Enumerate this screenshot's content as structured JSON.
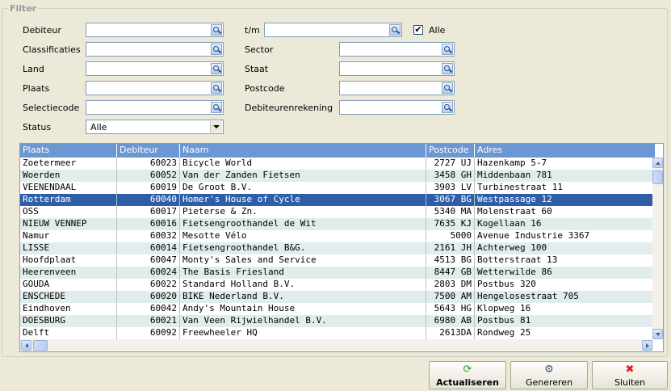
{
  "filter": {
    "title": "Filter",
    "labels": {
      "debiteur": "Debiteur",
      "tm": "t/m",
      "classificaties": "Classificaties",
      "sector": "Sector",
      "land": "Land",
      "staat": "Staat",
      "plaats": "Plaats",
      "postcode": "Postcode",
      "selectiecode": "Selectiecode",
      "debiteurenrekening": "Debiteurenrekening",
      "status": "Status",
      "alle": "Alle"
    },
    "alle_checked": "✔",
    "status_value": "Alle"
  },
  "grid": {
    "columns": [
      "Plaats",
      "Debiteur",
      "Naam",
      "Postcode",
      "Adres"
    ],
    "rows": [
      [
        "Zoetermeer",
        "60023",
        "Bicycle World",
        "2727 UJ",
        "Hazenkamp 5-7"
      ],
      [
        "Woerden",
        "60052",
        "Van der Zanden Fietsen",
        "3458 GH",
        "Middenbaan 781"
      ],
      [
        "VEENENDAAL",
        "60019",
        "De Groot B.V.",
        "3903 LV",
        "Turbinestraat 11"
      ],
      [
        "Rotterdam",
        "60040",
        "Homer's House of Cycle",
        "3067 BG",
        "Westpassage 12"
      ],
      [
        "OSS",
        "60017",
        "Pieterse & Zn.",
        "5340 MA",
        "Molenstraat 60"
      ],
      [
        "NIEUW VENNEP",
        "60016",
        "Fietsengroothandel de Wit",
        "7635 KJ",
        "Kogellaan 16"
      ],
      [
        "Namur",
        "60032",
        "Mesotte Vélo",
        "5000",
        "Avenue Industrie 3367"
      ],
      [
        "LISSE",
        "60014",
        "Fietsengroothandel B&G.",
        "2161 JH",
        "Achterweg 100"
      ],
      [
        "Hoofdplaat",
        "60047",
        "Monty's Sales and Service",
        "4513 BG",
        "Botterstraat 13"
      ],
      [
        "Heerenveen",
        "60024",
        "The Basis Friesland",
        "8447 GB",
        "Wetterwilde 86"
      ],
      [
        "GOUDA",
        "60022",
        "Standard Holland B.V.",
        "2803 DM",
        "Postbus 320"
      ],
      [
        "ENSCHEDE",
        "60020",
        "BIKE Nederland B.V.",
        "7500 AM",
        "Hengelosestraat 705"
      ],
      [
        "Eindhoven",
        "60042",
        "Andy's Mountain House",
        "5643 HG",
        "Klopweg 16"
      ],
      [
        "DOESBURG",
        "60021",
        "Van Veen Rijwielhandel B.V.",
        "6980 AB",
        "Postbus 81"
      ],
      [
        "Delft",
        "60092",
        "Freewheeler HQ",
        "2613DA",
        "Rondweg 25"
      ]
    ],
    "selected_row": 3
  },
  "buttons": {
    "actualiseren": "Actualiseren",
    "genereren": "Genereren",
    "sluiten": "Sluiten"
  },
  "icons": {
    "refresh": "refresh-icon",
    "gear": "gear-icon",
    "close": "close-icon"
  },
  "colors": {
    "header_bg": "#6b97d3",
    "selected_bg": "#2f5ea8",
    "alt_row_bg": "#e1ecec"
  }
}
